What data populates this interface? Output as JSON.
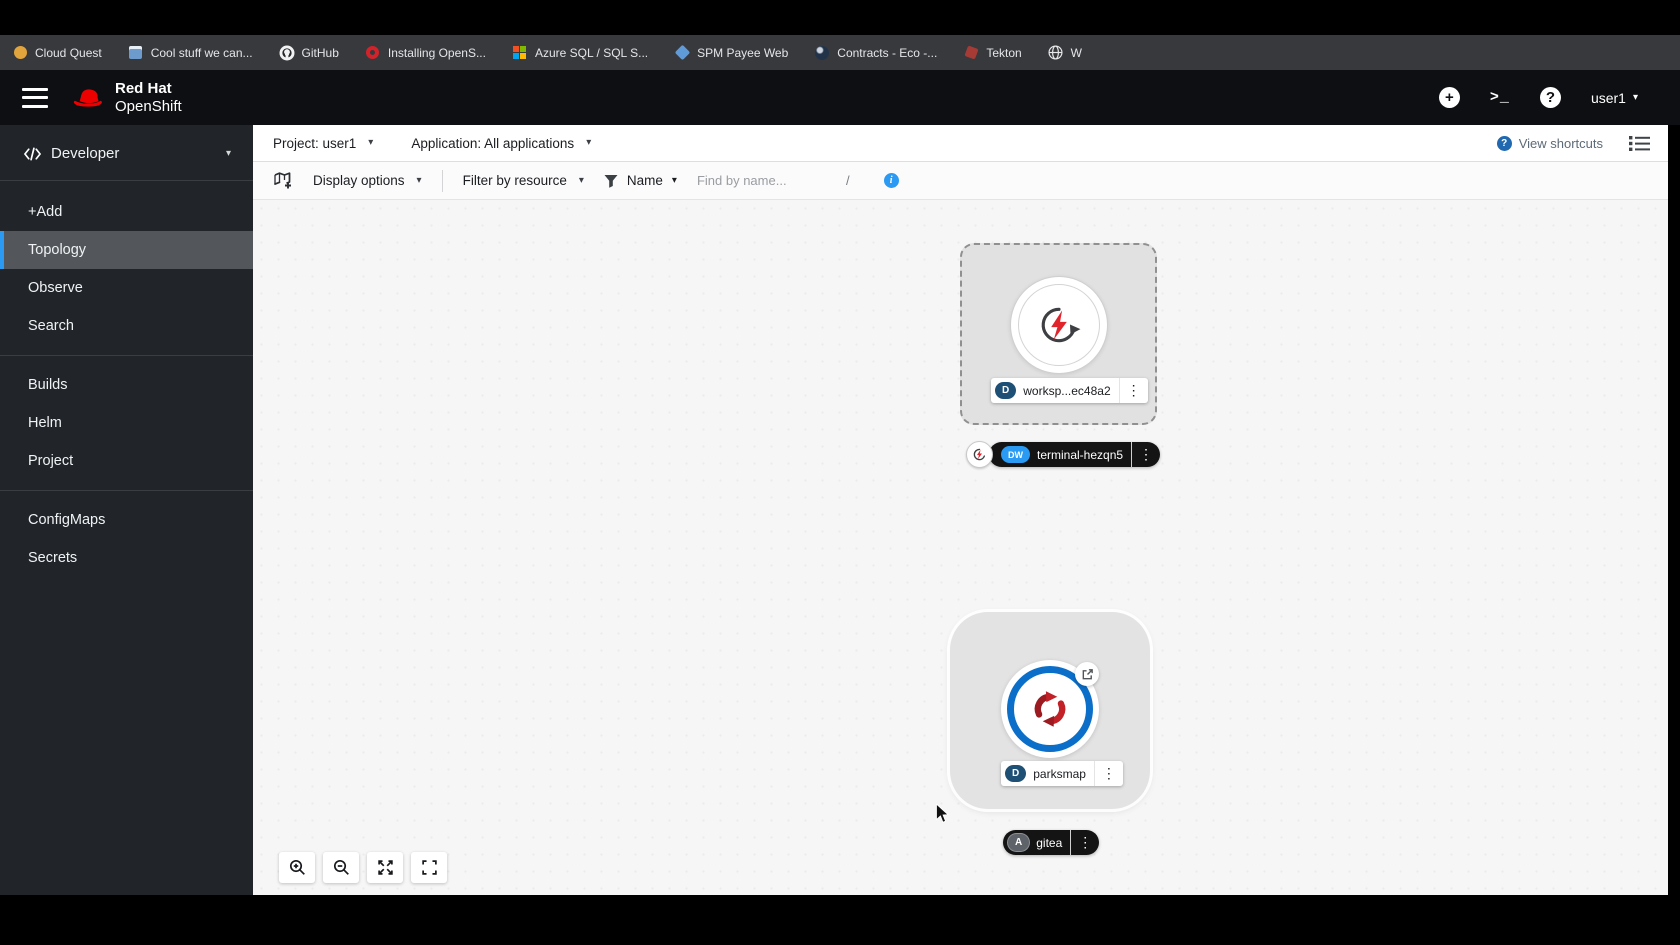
{
  "bookmarks": {
    "items": [
      "Cloud Quest",
      "Cool stuff we can...",
      "GitHub",
      "Installing OpenS...",
      "Azure SQL / SQL S...",
      "SPM Payee Web",
      "Contracts - Eco -...",
      "Tekton",
      "W"
    ]
  },
  "masthead": {
    "brand_line1": "Red Hat",
    "brand_line2": "OpenShift",
    "user": "user1"
  },
  "sidebar": {
    "perspective": "Developer",
    "items": [
      {
        "label": "+Add"
      },
      {
        "label": "Topology"
      },
      {
        "label": "Observe"
      },
      {
        "label": "Search"
      },
      {
        "label": "Builds"
      },
      {
        "label": "Helm"
      },
      {
        "label": "Project"
      },
      {
        "label": "ConfigMaps"
      },
      {
        "label": "Secrets"
      }
    ]
  },
  "context_bar": {
    "project": "Project: user1",
    "application": "Application: All applications",
    "view_shortcuts": "View shortcuts"
  },
  "toolbar": {
    "display_options": "Display options",
    "filter_by_resource": "Filter by resource",
    "name_filter": "Name",
    "find_placeholder": "Find by name...",
    "shortcut_key": "/"
  },
  "topology": {
    "nodes": {
      "workspace": {
        "badge": "D",
        "label": "worksp...ec48a2"
      },
      "terminal": {
        "badge": "DW",
        "label": "terminal-hezqn5"
      },
      "parksmap": {
        "badge": "D",
        "label": "parksmap"
      },
      "gitea": {
        "badge": "A",
        "label": "gitea"
      }
    }
  },
  "colors": {
    "accent_blue": "#2b9af3",
    "badge_deployment": "#1e4f75",
    "badge_devworkspace": "#2b9af3",
    "badge_application": "#5e6369",
    "node_ring_blue": "#0b6ec9",
    "che_red": "#e0242c",
    "parksmap_red": "#b01f26",
    "sidebar_bg": "#212529",
    "masthead_bg": "#0d0f12"
  }
}
